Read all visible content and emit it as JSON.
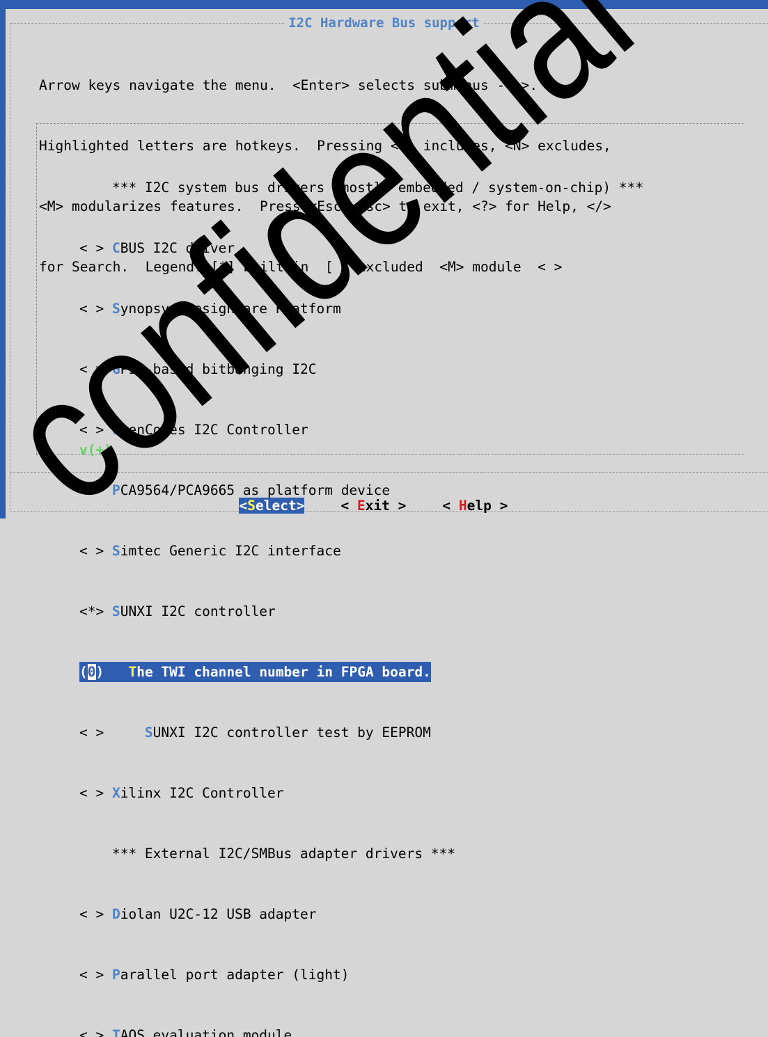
{
  "window": {
    "title": "I2C Hardware Bus support"
  },
  "help": {
    "line1": "Arrow keys navigate the menu.  <Enter> selects submenus --->.",
    "line2": "Highlighted letters are hotkeys.  Pressing <Y> includes, <N> excludes,",
    "line3": "<M> modularizes features.  Press <Esc><Esc> to exit, <?> for Help, </>",
    "line4": "for Search.  Legend: [*] built-in  [ ] excluded  <M> module  < >"
  },
  "menu": {
    "items": [
      {
        "prefix": "    *** ",
        "hotkey": "",
        "rest": "I2C system bus drivers (mostly embedded / system-on-chip) ***"
      },
      {
        "prefix": "< > ",
        "hotkey": "C",
        "rest": "BUS I2C driver"
      },
      {
        "prefix": "< > ",
        "hotkey": "S",
        "rest": "ynopsys DesignWare Platform"
      },
      {
        "prefix": "< > ",
        "hotkey": "G",
        "rest": "PIO-based bitbanging I2C"
      },
      {
        "prefix": "< > ",
        "hotkey": "O",
        "rest": "penCores I2C Controller"
      },
      {
        "prefix": "< > ",
        "hotkey": "P",
        "rest": "CA9564/PCA9665 as platform device"
      },
      {
        "prefix": "< > ",
        "hotkey": "S",
        "rest": "imtec Generic I2C interface"
      },
      {
        "prefix": "<*> ",
        "hotkey": "S",
        "rest": "UNXI I2C controller"
      },
      {
        "prefix": "(",
        "value": "0",
        "mid": ")   ",
        "hotkey": "T",
        "rest": "he TWI channel number in FPGA board."
      },
      {
        "prefix": "< >     ",
        "hotkey": "S",
        "rest": "UNXI I2C controller test by EEPROM"
      },
      {
        "prefix": "< > ",
        "hotkey": "X",
        "rest": "ilinx I2C Controller"
      },
      {
        "prefix": "    *** ",
        "hotkey": "",
        "rest": "External I2C/SMBus adapter drivers ***"
      },
      {
        "prefix": "< > ",
        "hotkey": "D",
        "rest": "iolan U2C-12 USB adapter"
      },
      {
        "prefix": "< > ",
        "hotkey": "P",
        "rest": "arallel port adapter (light)"
      },
      {
        "prefix": "< > ",
        "hotkey": "T",
        "rest": "AOS evaluation module"
      }
    ],
    "more_indicator": "v(+)"
  },
  "buttons": {
    "select": {
      "open": "<",
      "hotkey": "S",
      "rest": "elect>"
    },
    "exit": {
      "open": "< ",
      "hotkey": "E",
      "rest": "xit >"
    },
    "help": {
      "open": "< ",
      "hotkey": "H",
      "rest": "elp >"
    }
  },
  "watermark": {
    "text": "confidential"
  },
  "colors": {
    "accent": "#2f5daf",
    "hotkey": "#4e83c6",
    "hotkey_selected": "#ffff55",
    "more_indicator": "#5ed45e",
    "button_hotkey": "#cc2222",
    "background": "#d6d6d6",
    "watermark": "#000000"
  }
}
